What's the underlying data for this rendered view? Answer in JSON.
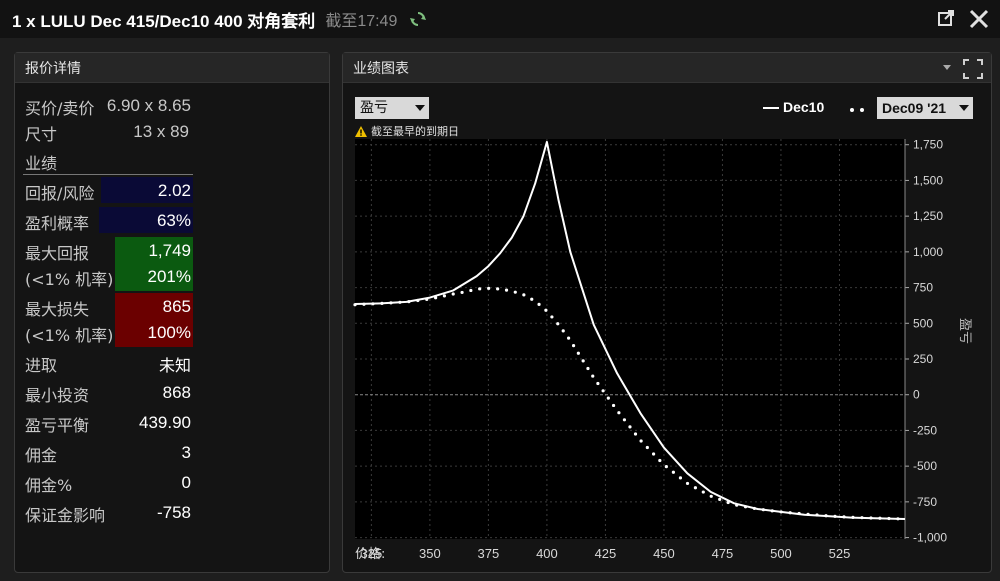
{
  "window": {
    "title": "1 x LULU Dec 415/Dec10 400 对角套利",
    "as_of": "截至17:49"
  },
  "quote_panel": {
    "header": "报价详情",
    "bid_ask_label": "买价/卖价",
    "bid_ask_value": "6.90 x 8.65",
    "size_label": "尺寸",
    "size_value": "13 x 89",
    "performance_label": "业绩",
    "return_risk_label": "回报/风险",
    "return_risk_value": "2.02",
    "prob_profit_label": "盈利概率",
    "prob_profit_value": "63%",
    "max_return_label": "最大回报",
    "max_return_value": "1,749",
    "max_return_sub_label": "(<1% 机率)",
    "max_return_pct": "201%",
    "max_loss_label": "最大损失",
    "max_loss_value": "865",
    "max_loss_sub_label": "(<1% 机率)",
    "max_loss_pct": "100%",
    "progress_label": "进取",
    "progress_value": "未知",
    "min_invest_label": "最小投资",
    "min_invest_value": "868",
    "breakeven_label": "盈亏平衡",
    "breakeven_value": "439.90",
    "commission_label": "佣金",
    "commission_value": "3",
    "commission_pct_label": "佣金%",
    "commission_pct_value": "0",
    "margin_label": "保证金影响",
    "margin_value": "-758"
  },
  "chart_panel": {
    "header": "业绩图表",
    "mode_select": "盈亏",
    "legend_series1": "Dec10",
    "date_select": "Dec09 '21",
    "warning": "截至最早的到期日",
    "price_label": "价格:",
    "y_axis_label": "盈亏"
  },
  "colors": {
    "return_risk_bg": "#0a0a36",
    "max_return_bg": "#0b5a10",
    "max_loss_bg": "#6b0000",
    "chart_bg": "#000000"
  },
  "chart_data": {
    "type": "line",
    "xlabel": "价格:",
    "ylabel": "盈亏",
    "xlim": [
      318,
      553
    ],
    "ylim": [
      -1010,
      1790
    ],
    "x_ticks": [
      325,
      350,
      375,
      400,
      425,
      450,
      475,
      500,
      525
    ],
    "y_ticks": [
      1750,
      1500,
      1250,
      1000,
      750,
      500,
      250,
      0,
      -250,
      -500,
      -750,
      -1000
    ],
    "y_tick_labels": [
      "1,750",
      "1,500",
      "1,250",
      "1,000",
      "750",
      "500",
      "250",
      "0",
      "-250",
      "-500",
      "-750",
      "-1,000"
    ],
    "series": [
      {
        "name": "Dec10",
        "style": "solid",
        "x": [
          318,
          330,
          340,
          350,
          360,
          370,
          375,
          380,
          385,
          390,
          395,
          400,
          405,
          410,
          420,
          430,
          440,
          450,
          460,
          470,
          480,
          490,
          500,
          510,
          520,
          530,
          540,
          553
        ],
        "y": [
          635,
          640,
          650,
          680,
          730,
          830,
          900,
          990,
          1100,
          1250,
          1480,
          1770,
          1360,
          1000,
          490,
          150,
          -130,
          -370,
          -550,
          -680,
          -760,
          -800,
          -820,
          -840,
          -850,
          -860,
          -865,
          -870
        ]
      },
      {
        "name": "Dec09 '21",
        "style": "dotted",
        "x": [
          318,
          330,
          340,
          350,
          360,
          365,
          370,
          375,
          380,
          385,
          390,
          395,
          400,
          405,
          410,
          420,
          430,
          440,
          450,
          460,
          470,
          480,
          490,
          500,
          510,
          520,
          530,
          540,
          553
        ],
        "y": [
          630,
          640,
          650,
          670,
          705,
          720,
          740,
          745,
          740,
          725,
          700,
          655,
          585,
          490,
          380,
          120,
          -110,
          -320,
          -490,
          -620,
          -710,
          -770,
          -800,
          -820,
          -835,
          -848,
          -858,
          -864,
          -870
        ]
      }
    ]
  }
}
